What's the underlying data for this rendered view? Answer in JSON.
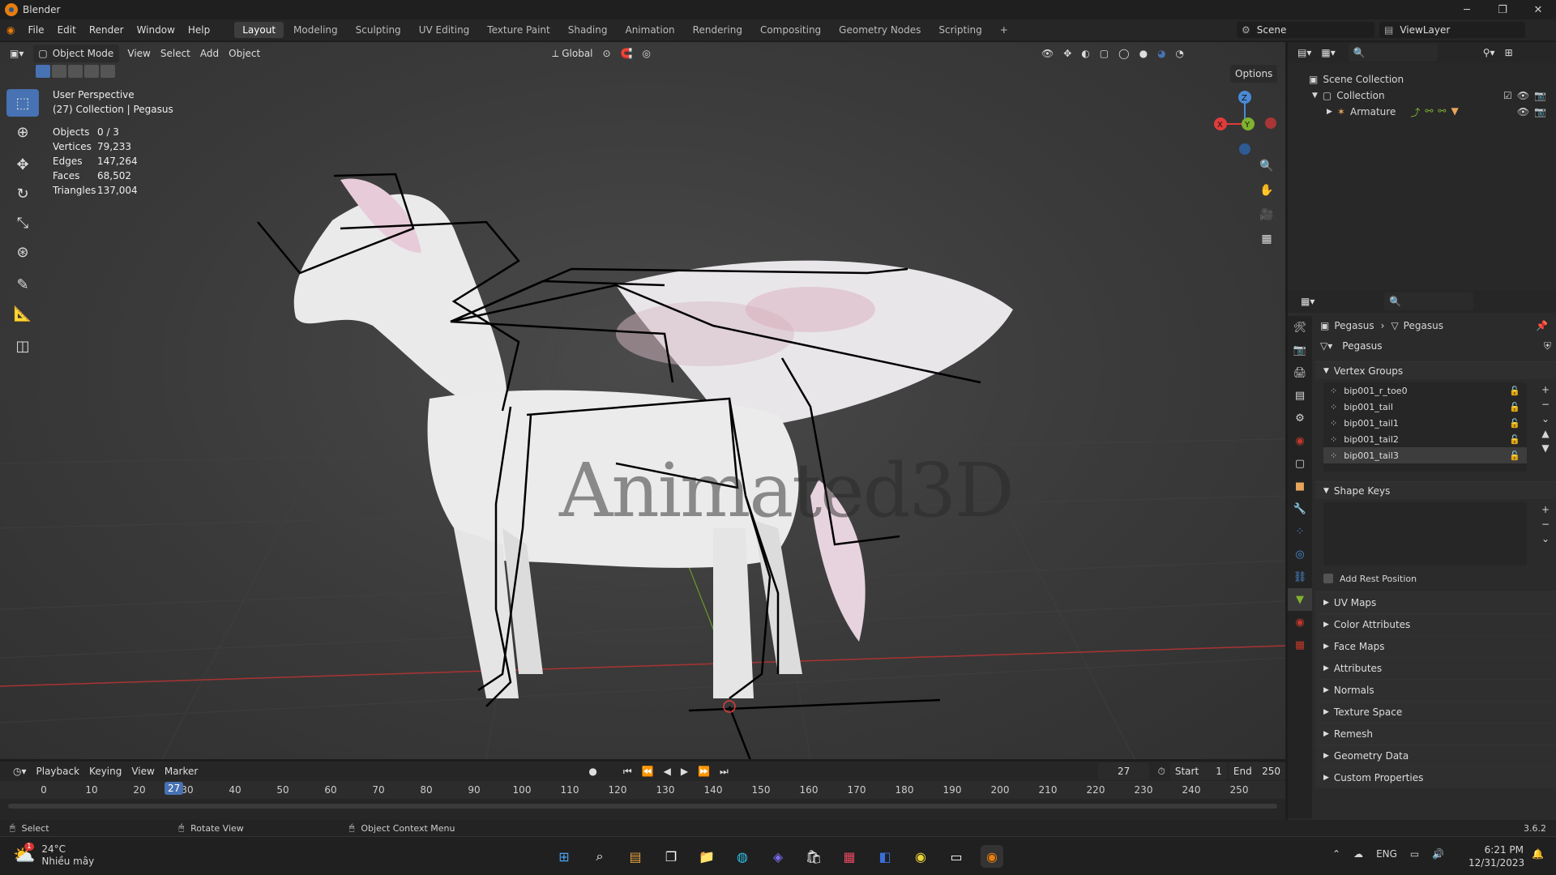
{
  "window": {
    "title": "Blender"
  },
  "menu": {
    "items": [
      "File",
      "Edit",
      "Render",
      "Window",
      "Help"
    ]
  },
  "workspaces": {
    "tabs": [
      "Layout",
      "Modeling",
      "Sculpting",
      "UV Editing",
      "Texture Paint",
      "Shading",
      "Animation",
      "Rendering",
      "Compositing",
      "Geometry Nodes",
      "Scripting"
    ],
    "active": "Layout",
    "add": "+"
  },
  "scene": {
    "label": "Scene",
    "viewlayer": "ViewLayer"
  },
  "viewport_header": {
    "mode": "Object Mode",
    "menus": [
      "View",
      "Select",
      "Add",
      "Object"
    ],
    "orientation": "Global",
    "options": "Options"
  },
  "overlay": {
    "perspective": "User Perspective",
    "collection": "(27) Collection | Pegasus",
    "stats": [
      {
        "k": "Objects",
        "v": "0 / 3"
      },
      {
        "k": "Vertices",
        "v": "79,233"
      },
      {
        "k": "Edges",
        "v": "147,264"
      },
      {
        "k": "Faces",
        "v": "68,502"
      },
      {
        "k": "Triangles",
        "v": "137,004"
      }
    ],
    "watermark": "Animated3D"
  },
  "gizmo": {
    "x": "X",
    "y": "Y",
    "z": "Z"
  },
  "timeline": {
    "menus": [
      "Playback",
      "Keying",
      "View",
      "Marker"
    ],
    "current_frame": "27",
    "start_label": "Start",
    "start": "1",
    "end_label": "End",
    "end": "250",
    "ticks": [
      "0",
      "10",
      "20",
      "30",
      "40",
      "50",
      "60",
      "70",
      "80",
      "90",
      "100",
      "110",
      "120",
      "130",
      "140",
      "150",
      "160",
      "170",
      "180",
      "190",
      "200",
      "210",
      "220",
      "230",
      "240",
      "250"
    ],
    "playhead": "27"
  },
  "statusbar": {
    "select": "Select",
    "rotate": "Rotate View",
    "context": "Object Context Menu",
    "version": "3.6.2"
  },
  "outliner": {
    "root": "Scene Collection",
    "collection": "Collection",
    "armature": "Armature"
  },
  "properties": {
    "breadcrumb": [
      "Pegasus",
      "Pegasus"
    ],
    "mesh_name": "Pegasus",
    "vertex_groups_title": "Vertex Groups",
    "vertex_groups": [
      "bip001_r_toe0",
      "bip001_tail",
      "bip001_tail1",
      "bip001_tail2",
      "bip001_tail3"
    ],
    "vertex_groups_selected": "bip001_tail3",
    "shape_keys_title": "Shape Keys",
    "add_rest_position": "Add Rest Position",
    "panels": [
      "UV Maps",
      "Color Attributes",
      "Face Maps",
      "Attributes",
      "Normals",
      "Texture Space",
      "Remesh",
      "Geometry Data",
      "Custom Properties"
    ]
  },
  "taskbar": {
    "weather_temp": "24°C",
    "weather_desc": "Nhiều mây",
    "lang": "ENG",
    "time": "6:21 PM",
    "date": "12/31/2023",
    "badge": "1"
  },
  "colors": {
    "accent": "#4772b3",
    "blender_orange": "#e87d0d",
    "axis_x": "#e03c3c",
    "axis_y": "#7fb32e",
    "axis_z": "#4a8ad6"
  }
}
